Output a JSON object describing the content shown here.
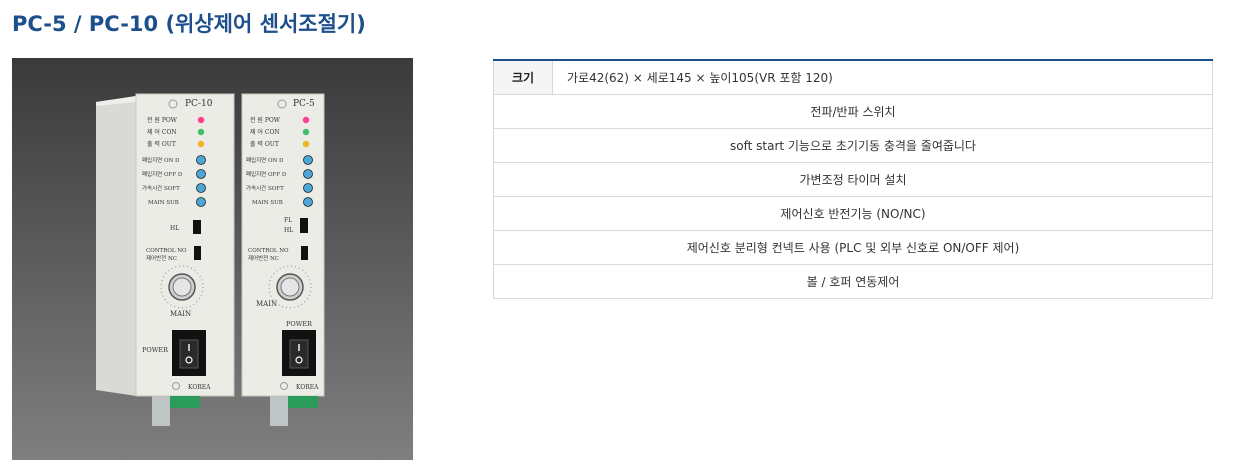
{
  "page": {
    "title": "PC-5 / PC-10 (위상제어 센서조절기)"
  },
  "photo": {
    "left_unit": {
      "model": "PC-10",
      "leds": [
        "전 원  POW",
        "제 어  CON",
        "출 력  OUT"
      ],
      "trimmers": [
        "폐입지연 ON D",
        "폐입지연 OFF D",
        "가속시간 SOFT",
        "MAIN  SUB"
      ],
      "switch_label": "HL",
      "control_labels": [
        "CONTROL  NO",
        "제어반전  NC"
      ],
      "dial_label": "MAIN",
      "power_label": "POWER",
      "korea_label": "KOREA"
    },
    "right_unit": {
      "model": "PC-5",
      "leds": [
        "전 원  POW",
        "제 어  CON",
        "출 력  OUT"
      ],
      "trimmers": [
        "폐입지연 ON D",
        "폐입지연 OFF D",
        "가속시간 SOFT",
        "MAIN  SUB"
      ],
      "switch_labels": [
        "FL",
        "HL"
      ],
      "control_labels": [
        "CONTROL  NO",
        "제어반전  NC"
      ],
      "dial_label": "MAIN",
      "power_label": "POWER",
      "korea_label": "KOREA"
    }
  },
  "spec": {
    "size_label": "크기",
    "size_value": "가로42(62) × 세로145 × 높이105(VR 포함 120)",
    "features": [
      "전파/반파 스위치",
      "soft start 기능으로 초기기동 충격을 줄여줍니다",
      "가변조정 타이머 설치",
      "제어신호 반전기능 (NO/NC)",
      "제어신호 분리형 컨넥트 사용 (PLC 및 외부 신호로 ON/OFF 제어)",
      "볼 / 호퍼 연동제어"
    ]
  }
}
